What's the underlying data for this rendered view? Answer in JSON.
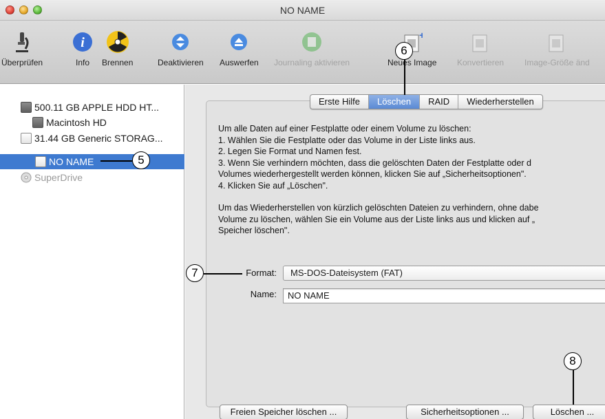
{
  "window": {
    "title": "NO NAME"
  },
  "toolbar": [
    {
      "label": "Überprüfen",
      "icon": "microscope-icon",
      "disabled": false
    },
    {
      "label": "Info",
      "icon": "info-icon",
      "disabled": false
    },
    {
      "label": "Brennen",
      "icon": "burn-icon",
      "disabled": false
    },
    {
      "label": "Deaktivieren",
      "icon": "unmount-icon",
      "disabled": false
    },
    {
      "label": "Auswerfen",
      "icon": "eject-icon",
      "disabled": false
    },
    {
      "label": "Journaling aktivieren",
      "icon": "journaling-icon",
      "disabled": true
    },
    {
      "label": "Neues Image",
      "icon": "new-image-icon",
      "disabled": false
    },
    {
      "label": "Konvertieren",
      "icon": "convert-icon",
      "disabled": true
    },
    {
      "label": "Image-Größe änd",
      "icon": "resize-image-icon",
      "disabled": true
    }
  ],
  "sidebar": {
    "items": [
      {
        "label": "500.11 GB APPLE HDD HT...",
        "icon": "hard-disk-icon"
      },
      {
        "label": "Macintosh HD",
        "icon": "volume-icon"
      },
      {
        "label": "31.44 GB Generic STORAG...",
        "icon": "external-disk-icon"
      },
      {
        "label": "NO NAME",
        "icon": "volume-icon",
        "selected": true
      },
      {
        "label": "SuperDrive",
        "icon": "optical-drive-icon"
      }
    ]
  },
  "tabs": [
    {
      "label": "Erste Hilfe",
      "active": false
    },
    {
      "label": "Löschen",
      "active": true
    },
    {
      "label": "RAID",
      "active": false
    },
    {
      "label": "Wiederherstellen",
      "active": false
    }
  ],
  "instructions": {
    "intro": "Um alle Daten auf einer Festplatte oder einem Volume zu löschen:",
    "step1": "1.    Wählen Sie die Festplatte oder das Volume in der Liste links aus.",
    "step2": "2.    Legen Sie Format und Namen fest.",
    "step3a": "3.    Wenn Sie verhindern möchten, dass die gelöschten Daten der Festplatte oder d",
    "step3b": "Volumes wiederhergestellt werden können, klicken Sie auf „Sicherheitsoptionen\".",
    "step4": "4.    Klicken Sie auf „Löschen\".",
    "para2a": "Um das Wiederherstellen von kürzlich gelöschten Dateien zu verhindern, ohne dabe",
    "para2b": "Volume zu löschen, wählen Sie ein Volume aus der Liste links aus und klicken auf „",
    "para2c": "Speicher löschen\"."
  },
  "form": {
    "format_label": "Format:",
    "format_value": "MS-DOS-Dateisystem (FAT)",
    "name_label": "Name:",
    "name_value": "NO NAME"
  },
  "buttons": {
    "free_space": "Freien Speicher löschen ...",
    "security": "Sicherheitsoptionen ...",
    "erase": "Löschen ..."
  },
  "callouts": {
    "c5": "5",
    "c6": "6",
    "c7": "7",
    "c8": "8"
  },
  "colors": {
    "selection": "#3e7ad0",
    "active_tab": "#5a8ad4"
  }
}
